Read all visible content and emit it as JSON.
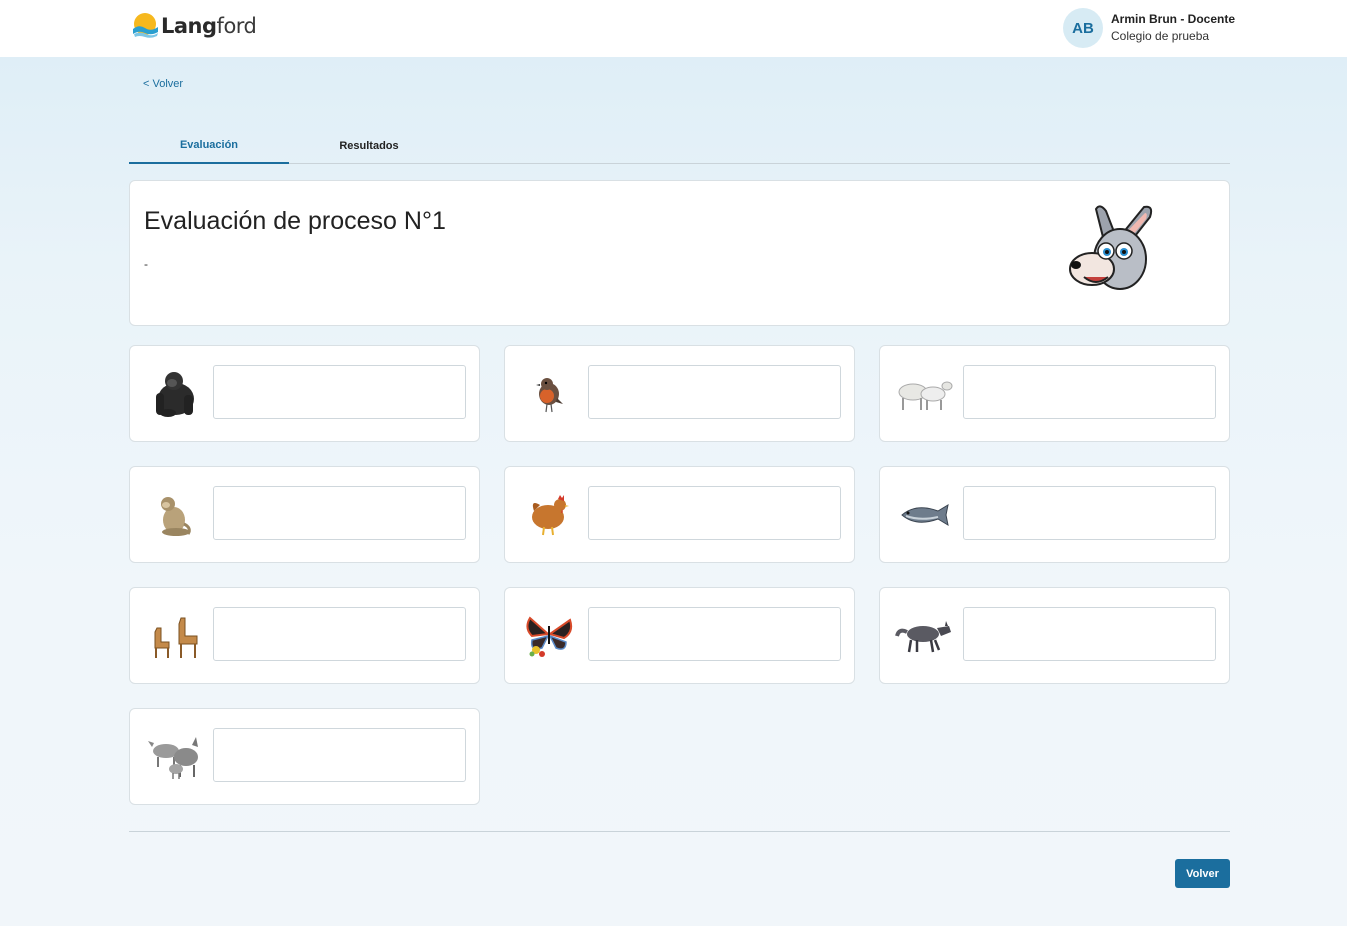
{
  "app": {
    "logo": {
      "bold": "Lang",
      "light": "ford"
    }
  },
  "user": {
    "initials": "AB",
    "name": "Armin Brun - Docente",
    "school": "Colegio de prueba"
  },
  "nav": {
    "back_label": "< Volver"
  },
  "tabs": [
    {
      "label": "Evaluación",
      "active": true
    },
    {
      "label": "Resultados",
      "active": false
    }
  ],
  "evaluation": {
    "title": "Evaluación de proceso N°1",
    "subtitle": "-"
  },
  "items": [
    {
      "animal": "gorilla-icon",
      "value": ""
    },
    {
      "animal": "robin-icon",
      "value": ""
    },
    {
      "animal": "sheep-icon",
      "value": ""
    },
    {
      "animal": "monkey-icon",
      "value": ""
    },
    {
      "animal": "hen-icon",
      "value": ""
    },
    {
      "animal": "fish-icon",
      "value": ""
    },
    {
      "animal": "giraffe-icon",
      "value": ""
    },
    {
      "animal": "butterfly-icon",
      "value": ""
    },
    {
      "animal": "wolf-icon",
      "value": ""
    },
    {
      "animal": "donkey-icon",
      "value": ""
    }
  ],
  "footer": {
    "volver_label": "Volver"
  },
  "colors": {
    "accent": "#1b6e9e",
    "avatar_bg": "#d7ebf4"
  }
}
